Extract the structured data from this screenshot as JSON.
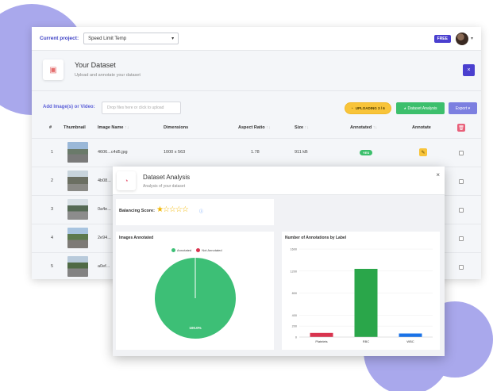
{
  "topbar": {
    "current_project_label": "Current project:",
    "project_value": "Speed Limit Temp",
    "plan_badge": "FREE"
  },
  "dataset": {
    "title": "Your Dataset",
    "subtitle": "Upload and annotate your dataset",
    "close": "×"
  },
  "upload": {
    "label": "Add Image(s) or Video:",
    "placeholder": "Drop files here or click to upload",
    "status": "UPLOADING 3 / 6",
    "analysis_button": "Dataset Analysis",
    "export_button": "Export ▾"
  },
  "table": {
    "headers": [
      "#",
      "Thumbnail",
      "Image Name",
      "Dimensions",
      "Aspect Ratio",
      "Size",
      "Annotated",
      "Annotate"
    ],
    "sort_marker": "↑↓",
    "rows": [
      {
        "index": "1",
        "name": "4606...c4d5.jpg",
        "dimensions": "1000 x 563",
        "aspect": "1.78",
        "size": "911 kB",
        "annotated": "YES"
      },
      {
        "index": "2",
        "name": "4b08..."
      },
      {
        "index": "3",
        "name": "0a4e..."
      },
      {
        "index": "4",
        "name": "2e94..."
      },
      {
        "index": "5",
        "name": "a0ef..."
      }
    ]
  },
  "modal": {
    "title": "Dataset Analysis",
    "subtitle": "Analysis of your dataset",
    "close": "×",
    "balancing_label": "Balancing Score:",
    "stars": "☆☆☆☆☆",
    "stars_filled": 1,
    "info_icon": "ⓘ"
  },
  "colors": {
    "accent": "#4a3fcf",
    "green": "#3cbf6c",
    "yellow": "#f8c43a",
    "pie_annotated": "#3dbf76",
    "pie_not_annotated": "#d9344f",
    "bar_red": "#d9344f",
    "bar_green": "#2aa64a",
    "bar_blue": "#1a73e8"
  },
  "chart_data": [
    {
      "type": "pie",
      "title": "Images Annotated",
      "labels": [
        "Annotated",
        "Not Annotated"
      ],
      "values": [
        100,
        0
      ],
      "slice_label": "100.0%"
    },
    {
      "type": "bar",
      "title": "Number of Annotations by Label",
      "categories": [
        "Platelets",
        "RBC",
        "WBC"
      ],
      "values": [
        75,
        1240,
        65
      ],
      "ylim": [
        0,
        1600
      ],
      "yticks": [
        "0",
        "200",
        "400",
        "800",
        "1200",
        "1600"
      ],
      "ytick_values": [
        0,
        200,
        400,
        800,
        1200,
        1600
      ]
    }
  ]
}
